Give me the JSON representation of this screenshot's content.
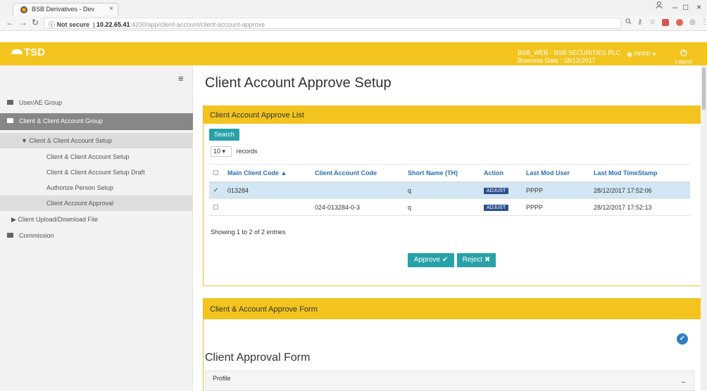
{
  "browser": {
    "tab_title": "BSB Derivatives - Dev",
    "tab_close": "×",
    "security": "Not secure",
    "url_host": "10.22.65.41",
    "url_path": ":4200/app/client-account/client-account-approve",
    "win_minimize": "–",
    "win_maximize": "□",
    "win_close": "×"
  },
  "header": {
    "logo": "TSD",
    "company": "BSB_WEB - BSB SECURITIES PLC.",
    "business_date": "Business Date : 18/12/2017",
    "user": "PPPP ▾",
    "logout": "Logout"
  },
  "sidebar": {
    "items": [
      {
        "label": "User/AE Group"
      },
      {
        "label": "Client & Client Account Group"
      },
      {
        "label": "▼ Client & Client Account Setup"
      },
      {
        "label": "Client & Client Account Setup"
      },
      {
        "label": "Client & Client Account Setup Draft"
      },
      {
        "label": "Authorize Person Setup"
      },
      {
        "label": "Client Account Approval"
      },
      {
        "label": "▶ Client Upload/Download File"
      },
      {
        "label": "Commission"
      }
    ]
  },
  "main": {
    "title": "Client Account Approve Setup",
    "list_panel_title": "Client Account Approve List",
    "search_label": "Search",
    "page_size": "10",
    "records_label": "records",
    "columns": [
      "Main Client Code ▲",
      "Client Account Code",
      "Short Name (TH)",
      "Action",
      "Last Mod User",
      "Last Mod TimeStamp"
    ],
    "rows": [
      {
        "main_client_code": "013284",
        "client_account_code": "",
        "short_name": "q",
        "action": "ADJUST",
        "last_mod_user": "PPPP",
        "last_mod_timestamp": "28/12/2017 17:52:06",
        "selected": true
      },
      {
        "main_client_code": "",
        "client_account_code": "024-013284-0-3",
        "short_name": "q",
        "action": "ADJUST",
        "last_mod_user": "PPPP",
        "last_mod_timestamp": "28/12/2017 17:52:13",
        "selected": false
      }
    ],
    "showing": "Showing 1 to 2 of 2 entries",
    "approve_label": "Approve ✔",
    "reject_label": "Reject ✖",
    "form_panel_title": "Client & Account Approve Form",
    "form_title": "Client Approval Form",
    "profile_label": "Profile"
  },
  "colors": {
    "accent_yellow": "#f3c41e",
    "teal_button": "#27a2a8",
    "adjust_badge": "#2c4f8e",
    "selected_row": "#d2e6f3"
  }
}
